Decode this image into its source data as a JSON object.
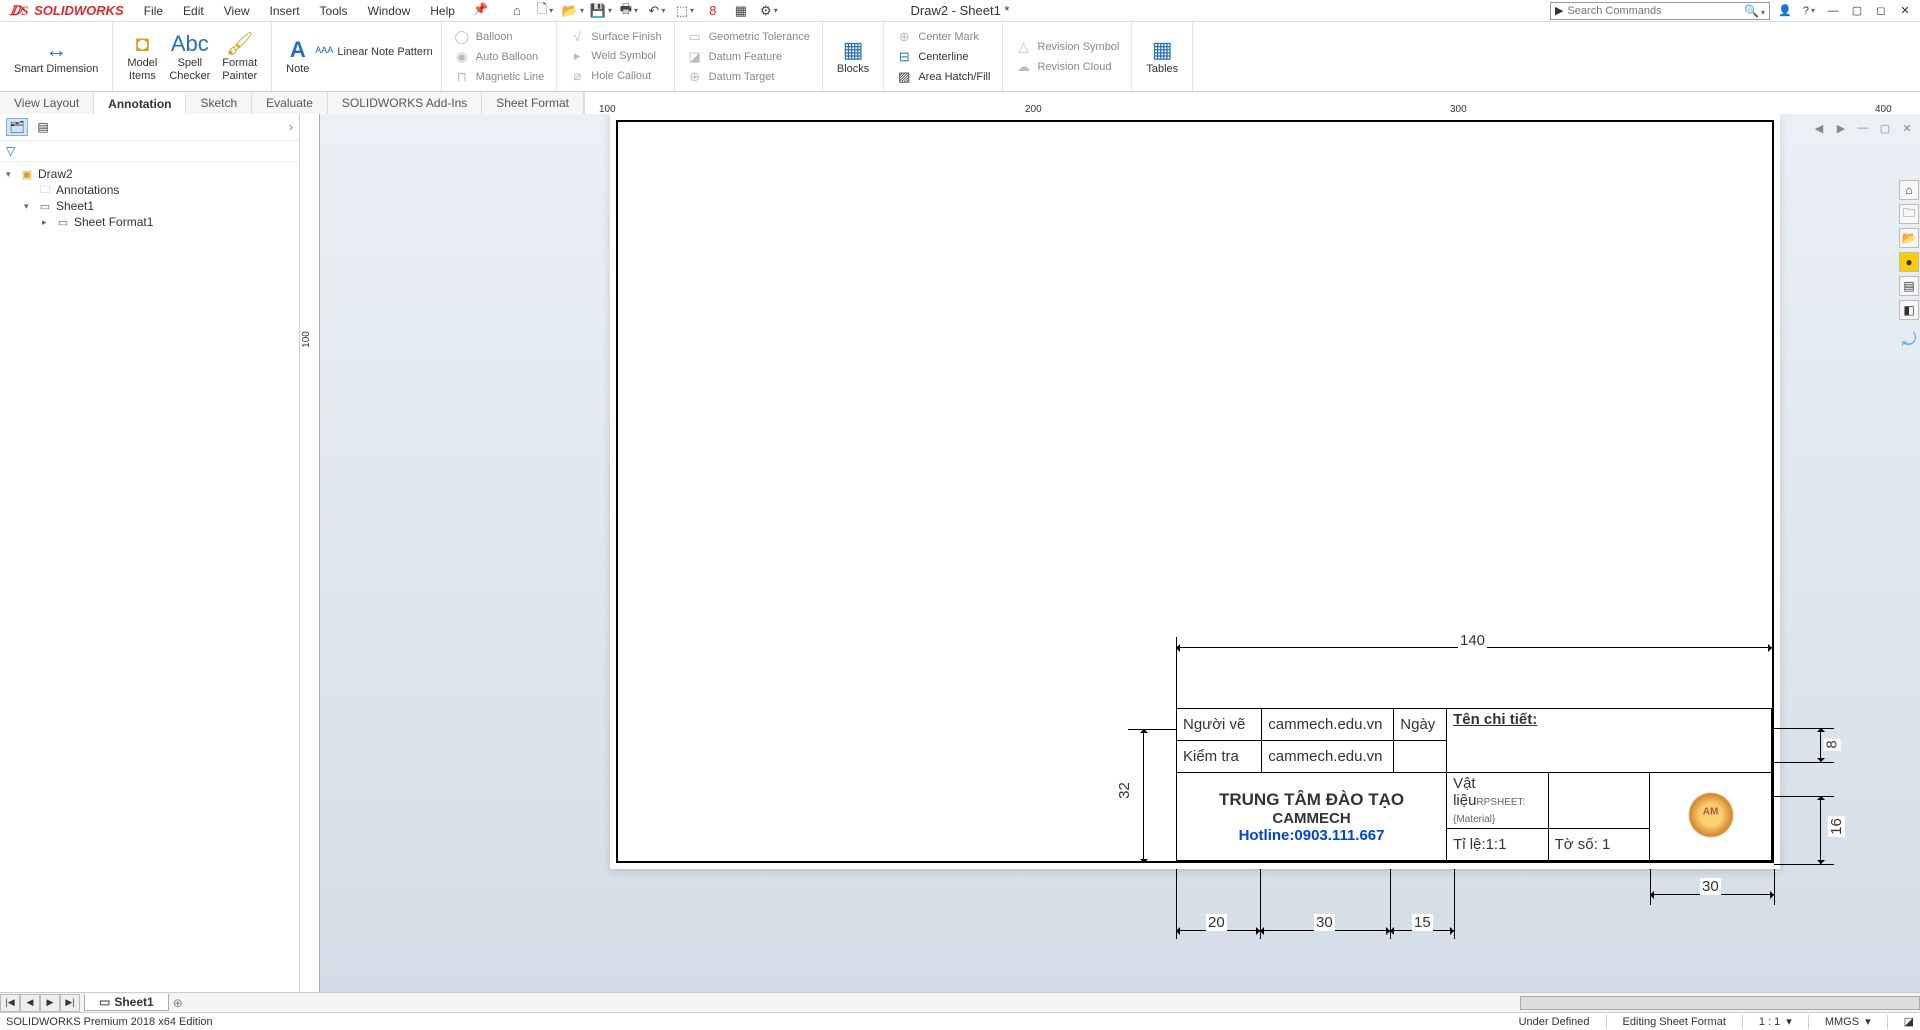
{
  "app": {
    "name": "SOLIDWORKS",
    "doc_title": "Draw2 - Sheet1 *"
  },
  "menu": [
    "File",
    "Edit",
    "View",
    "Insert",
    "Tools",
    "Window",
    "Help"
  ],
  "search_placeholder": "Search Commands",
  "ribbon": {
    "smart_dim": "Smart Dimension",
    "model_items": "Model\nItems",
    "spell": "Spell\nChecker",
    "format_painter": "Format\nPainter",
    "note": "Note",
    "linear_pattern": "Linear Note Pattern",
    "balloon": "Balloon",
    "auto_balloon": "Auto Balloon",
    "magnetic_line": "Magnetic Line",
    "surface_finish": "Surface Finish",
    "weld_symbol": "Weld Symbol",
    "hole_callout": "Hole Callout",
    "geo_tol": "Geometric Tolerance",
    "datum_feature": "Datum Feature",
    "datum_target": "Datum Target",
    "blocks": "Blocks",
    "center_mark": "Center Mark",
    "centerline": "Centerline",
    "area_hatch": "Area Hatch/Fill",
    "rev_symbol": "Revision Symbol",
    "rev_cloud": "Revision Cloud",
    "tables": "Tables"
  },
  "tabs": [
    "View Layout",
    "Annotation",
    "Sketch",
    "Evaluate",
    "SOLIDWORKS Add-Ins",
    "Sheet Format"
  ],
  "active_tab": 1,
  "tree": {
    "root": "Draw2",
    "annotations": "Annotations",
    "sheet": "Sheet1",
    "sheet_format": "Sheet Format1"
  },
  "ruler_marks": [
    "100",
    "200",
    "300",
    "400"
  ],
  "vruler_mark": "100",
  "titleblock": {
    "drawer_label": "Người vẽ",
    "drawer_value": "cammech.edu.vn",
    "date_label": "Ngày",
    "detail_label": "Tên chi tiết:",
    "checker_label": "Kiểm tra",
    "checker_value": "cammech.edu.vn",
    "org_line1": "TRUNG TÂM ĐÀO TẠO",
    "org_line2": "CAMMECH",
    "hotline": "Hotline:0903.111.667",
    "material_label": "Vật liệu",
    "material_value": "RPSHEET:{Material}",
    "scale_label": "Tỉ lệ:1:1",
    "sheet_num": "Tờ số: 1"
  },
  "dims": {
    "w_total": "140",
    "h_total": "32",
    "w1": "20",
    "w2": "30",
    "w3": "15",
    "w_right": "30",
    "h1": "8",
    "h2": "16"
  },
  "sheet_tab": "Sheet1",
  "status": {
    "edition": "SOLIDWORKS Premium 2018 x64 Edition",
    "under_defined": "Under Defined",
    "editing": "Editing Sheet Format",
    "scale": "1 : 1",
    "units": "MMGS"
  }
}
